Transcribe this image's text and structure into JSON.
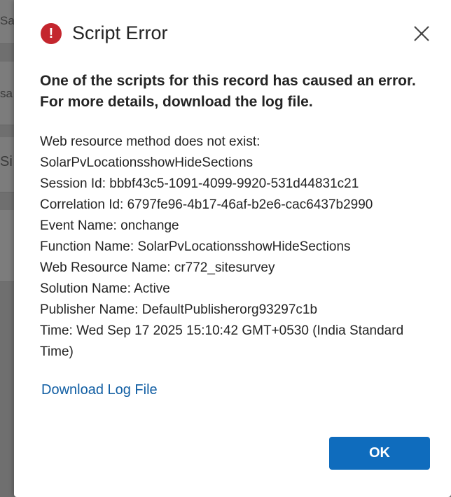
{
  "background": {
    "fragments": [
      "Sa",
      "sa",
      "Si"
    ]
  },
  "dialog": {
    "icon": "error-icon",
    "title": "Script Error",
    "close_icon": "close-icon",
    "headline": "One of the scripts for this record has caused an error. For more details, download the log file.",
    "details": {
      "line1": "Web resource method does not exist:",
      "line2": "SolarPvLocationsshowHideSections",
      "line3": "Session Id: bbbf43c5-1091-4099-9920-531d44831c21",
      "line4": "Correlation Id: 6797fe96-4b17-46af-b2e6-cac6437b2990",
      "line5": "Event Name: onchange",
      "line6": "Function Name: SolarPvLocationsshowHideSections",
      "line7": "Web Resource Name: cr772_sitesurvey",
      "line8": "Solution Name: Active",
      "line9": "Publisher Name: DefaultPublisherorg93297c1b",
      "line10": "Time: Wed Sep 17 2025 15:10:42 GMT+0530 (India Standard Time)"
    },
    "download_link": "Download Log File",
    "ok_label": "OK"
  },
  "colors": {
    "error": "#c4262e",
    "link": "#115ea3",
    "primary_button": "#0f6cbd"
  }
}
